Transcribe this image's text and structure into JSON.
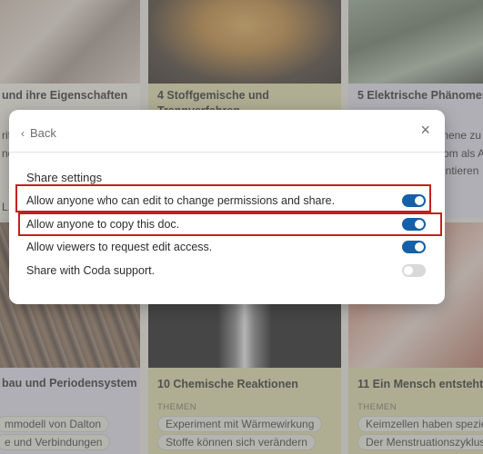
{
  "cards": [
    {
      "title": "und ihre Eigenschaften",
      "lines": [
        "rif",
        "nen",
        "L."
      ]
    },
    {
      "title": "4  Stoffgemische und",
      "title2": "Trennverfahren"
    },
    {
      "title": "5  Elektrische Phänomene",
      "lines": [
        "mene zu",
        "rom als A",
        "entieren"
      ]
    },
    {
      "title": "bau und Periodensystem",
      "chips": [
        "mmodell von Dalton",
        "e und Verbindungen"
      ]
    },
    {
      "title": "10  Chemische Reaktionen",
      "themen": "THEMEN",
      "chips": [
        "Experiment mit Wärmewirkung",
        "Stoffe können sich verändern"
      ]
    },
    {
      "title": "11  Ein Mensch entsteht",
      "themen": "THEMEN",
      "chips": [
        "Keimzellen haben speziell",
        "Der Menstruationszyklus"
      ]
    }
  ],
  "dialog": {
    "back_label": "Back",
    "close_icon": "×",
    "section_title": "Share settings",
    "settings": [
      {
        "label": "Allow anyone who can edit to change permissions and share.",
        "on": true
      },
      {
        "label": "Allow anyone to copy this doc.",
        "on": true
      },
      {
        "label": "Allow viewers to request edit access.",
        "on": true
      },
      {
        "label": "Share with Coda support.",
        "on": false
      }
    ]
  },
  "colors": {
    "toggle_on": "#1560a8",
    "toggle_off": "#d9d9d9",
    "highlight": "#c0221f"
  }
}
